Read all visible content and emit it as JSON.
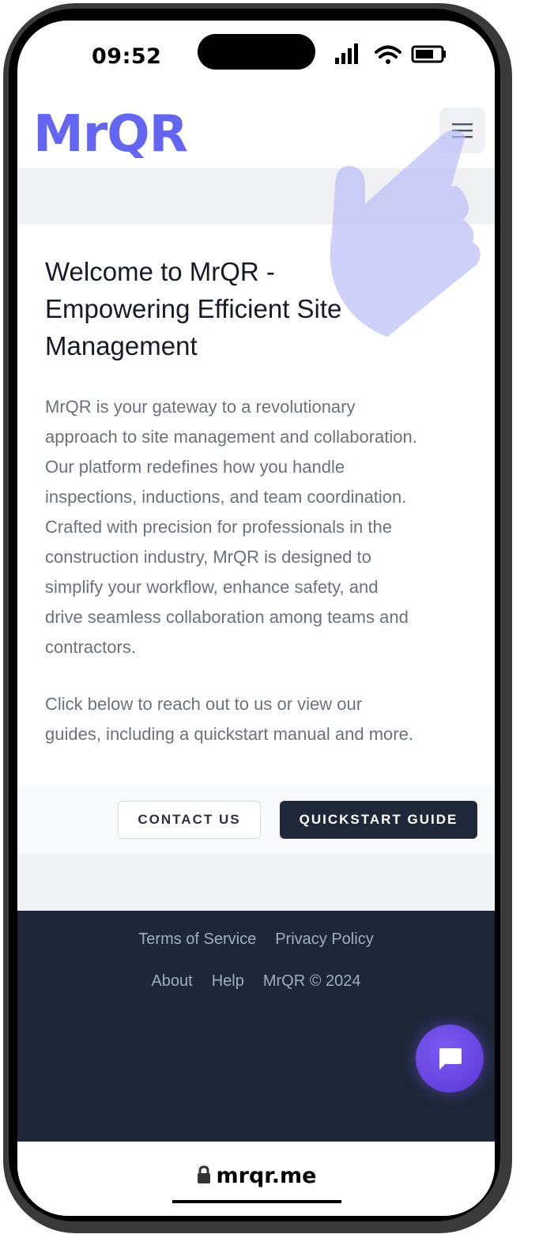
{
  "status_bar": {
    "time": "09:52"
  },
  "header": {
    "logo_text": "MrQR",
    "menu_icon": "hamburger-menu-icon"
  },
  "main": {
    "headline_lines": [
      "Welcome to MrQR -",
      "Empowering Efficient Site",
      "Management"
    ],
    "paragraph_1_lines": [
      "MrQR is your gateway to a revolutionary",
      "approach to site management and collaboration.",
      "Our platform redefines how you handle",
      "inspections, inductions, and team coordination.",
      "Crafted with precision for professionals in the",
      "construction industry, MrQR is designed to",
      "simplify your workflow, enhance safety, and",
      "drive seamless collaboration among teams and",
      "contractors."
    ],
    "paragraph_2_lines": [
      "Click below to reach out to us or view our",
      "guides, including a quickstart manual and more."
    ],
    "contact_button": "CONTACT US",
    "quickstart_button": "QUICKSTART GUIDE"
  },
  "footer": {
    "links_row_1": [
      "Terms of Service",
      "Privacy Policy"
    ],
    "links_row_2": [
      "About",
      "Help",
      "MrQR © 2024"
    ],
    "chat_icon": "chat-bubble-icon"
  },
  "browser": {
    "url": "mrqr.me",
    "lock_icon": "lock-icon"
  },
  "overlay": {
    "gesture_icon": "tap-hand-icon"
  },
  "colors": {
    "brand": "#6466f1",
    "dark": "#1e2738",
    "text_gray": "#6a7280",
    "chat_purple": "#6244e3"
  }
}
